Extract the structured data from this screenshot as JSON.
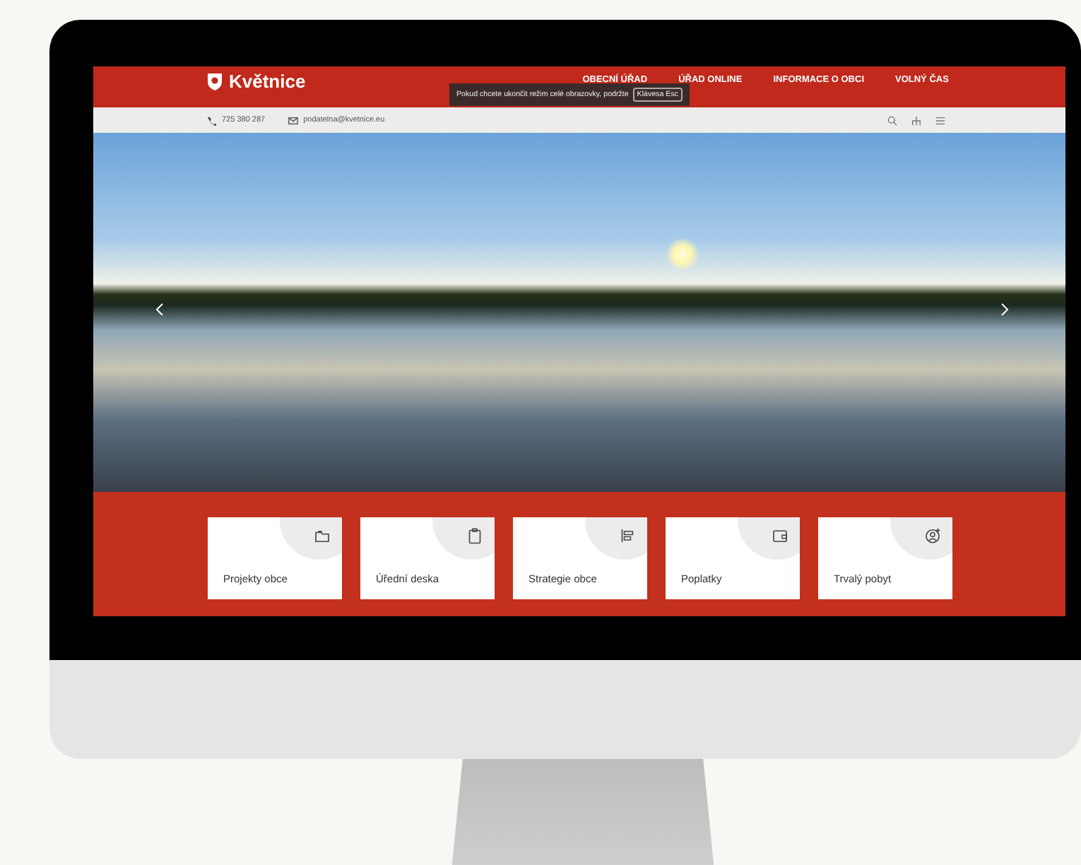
{
  "site": {
    "logo": "Květnice",
    "nav": [
      {
        "label": "OBECNÍ ÚŘAD"
      },
      {
        "label": "ÚŘAD ONLINE"
      },
      {
        "label": "INFORMACE O OBCI"
      },
      {
        "label": "VOLNÝ ČAS"
      }
    ],
    "phone": "725 380 287",
    "email": "podatelna@kvetnice.eu"
  },
  "fullscreen_notice": {
    "text": "Pokud chcete ukončit režim celé obrazovky, podržte",
    "key": "Klávesa Esc"
  },
  "tiles": [
    {
      "label": "Projekty obce",
      "kind": "folder"
    },
    {
      "label": "Úřední deska",
      "kind": "clipboard"
    },
    {
      "label": "Strategie obce",
      "kind": "bars"
    },
    {
      "label": "Poplatky",
      "kind": "wallet"
    },
    {
      "label": "Trvalý pobyt",
      "kind": "user"
    }
  ]
}
